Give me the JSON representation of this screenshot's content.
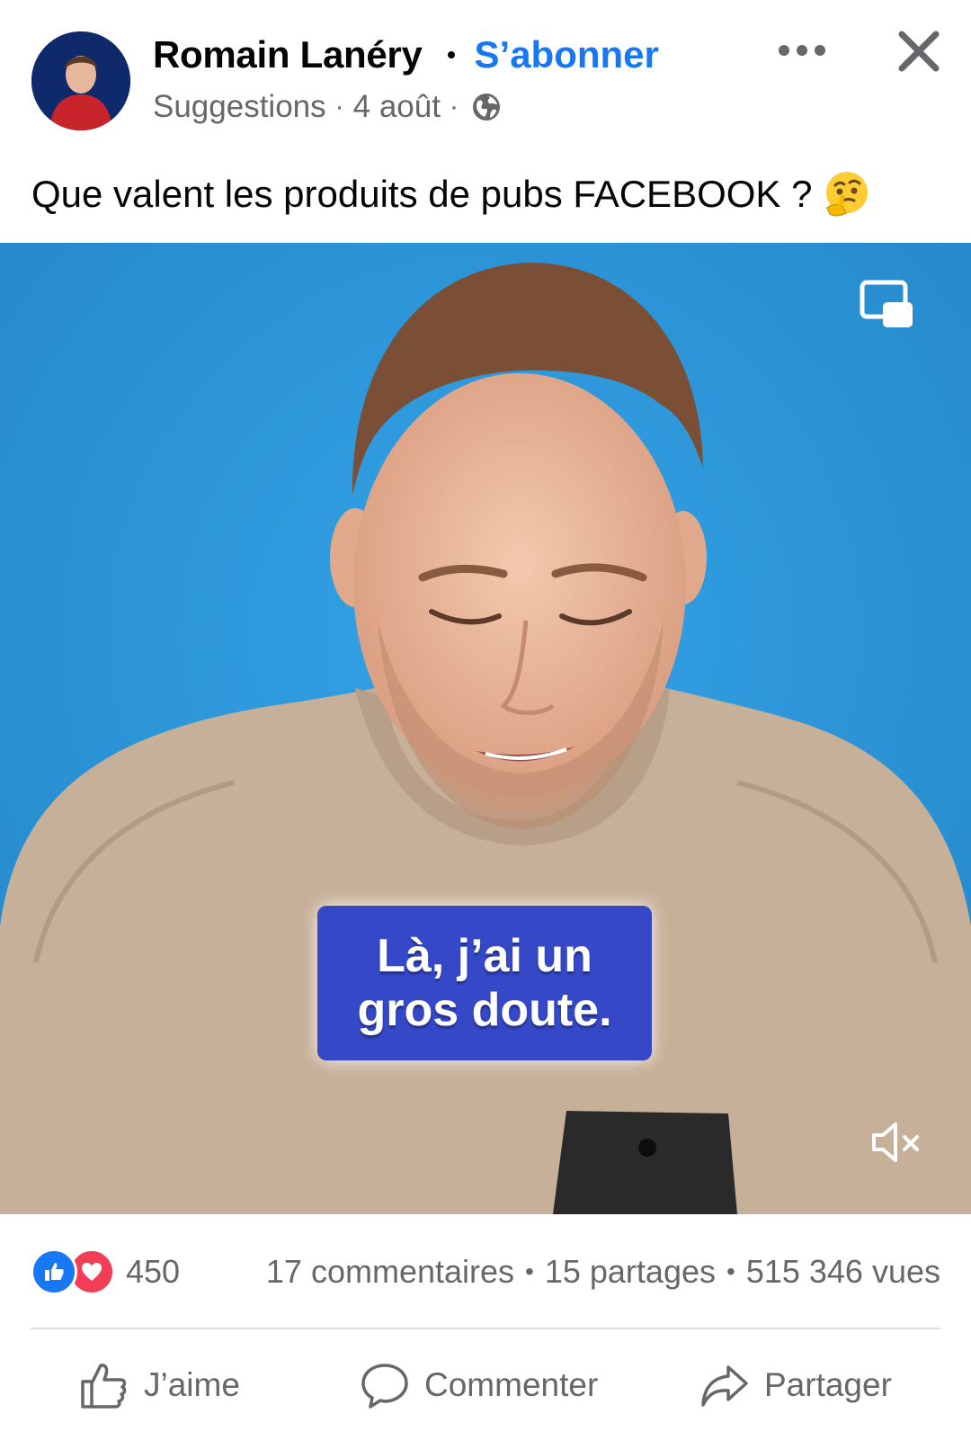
{
  "post": {
    "author": "Romain Lanéry",
    "follow_label": "S’abonner",
    "meta": {
      "context": "Suggestions",
      "date": "4 août",
      "audience_icon": "globe-icon"
    },
    "more_icon": "more-horizontal-icon",
    "close_icon": "close-icon",
    "caption": "Que valent les produits de pubs FACEBOOK ?",
    "caption_emoji": "thinking-face-emoji"
  },
  "video": {
    "subtitle_lines": [
      "Là, j’ai un",
      "gros doute."
    ],
    "pip_icon": "picture-in-picture-icon",
    "mute_icon": "speaker-muted-icon",
    "background_color": "#2a93d5",
    "subtitle_bg_color": "#3548c8"
  },
  "stats": {
    "reactions": [
      "like",
      "love"
    ],
    "reaction_count": "450",
    "comments": "17 commentaires",
    "shares": "15 partages",
    "views": "515 346 vues"
  },
  "actions": {
    "like_label": "J’aime",
    "comment_label": "Commenter",
    "share_label": "Partager"
  },
  "colors": {
    "accent": "#1877f2",
    "secondary_text": "#65676b",
    "primary_text": "#050505",
    "love": "#f33e58"
  }
}
